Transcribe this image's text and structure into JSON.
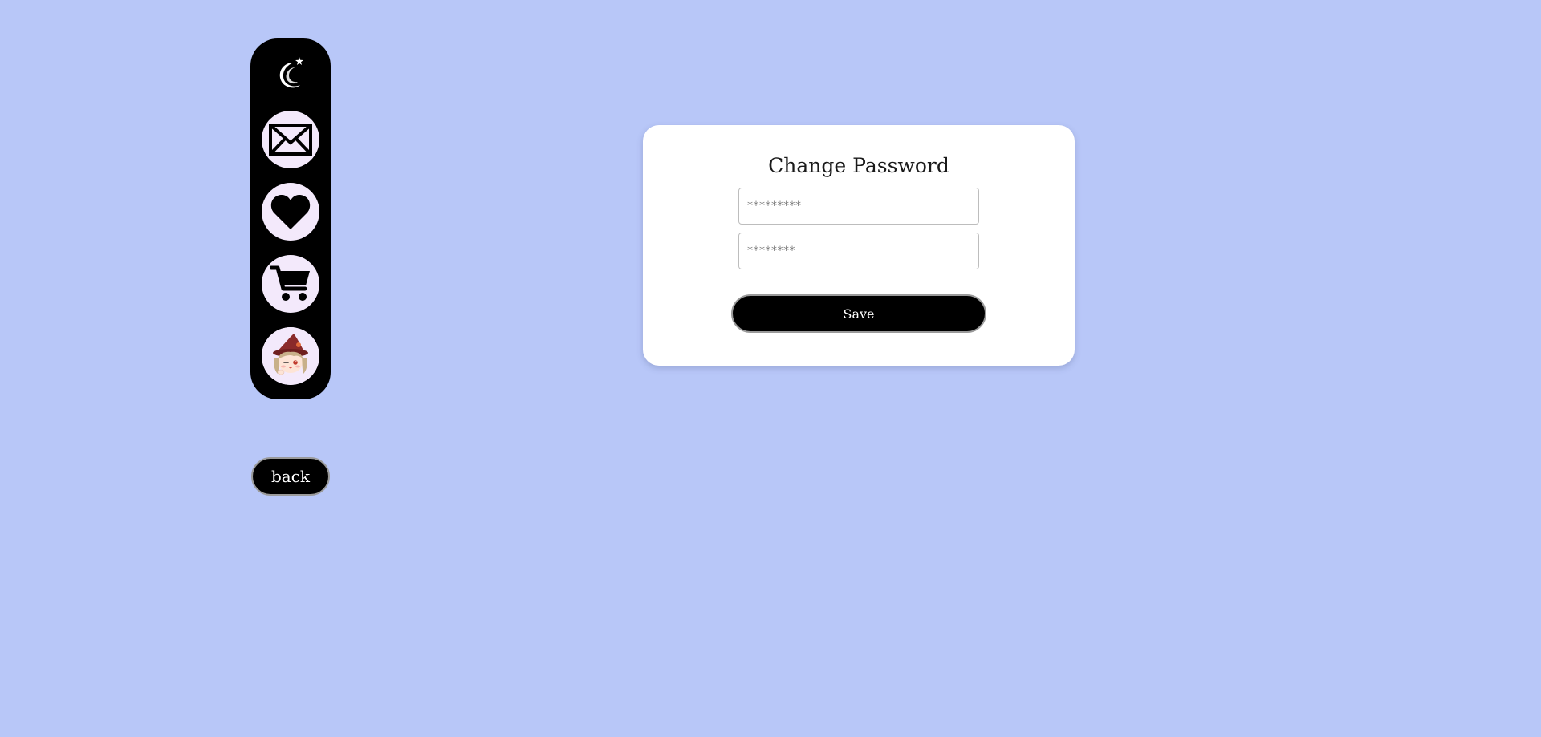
{
  "sidebar": {
    "logo_icon": "crescent-moon-star-icon",
    "items": [
      {
        "name": "messages",
        "icon": "envelope-icon"
      },
      {
        "name": "favorites",
        "icon": "heart-icon"
      },
      {
        "name": "cart",
        "icon": "shopping-cart-icon"
      },
      {
        "name": "profile",
        "icon": "avatar-icon"
      }
    ]
  },
  "back_button": {
    "label": "back"
  },
  "change_password": {
    "title": "Change Password",
    "new_password_placeholder": "*********",
    "confirm_password_placeholder": "********",
    "save_label": "Save"
  },
  "colors": {
    "background": "#b8c7f8",
    "sidebar": "#000000",
    "nav_circle": "#f3e9fb",
    "card": "#ffffff",
    "button": "#000000"
  }
}
